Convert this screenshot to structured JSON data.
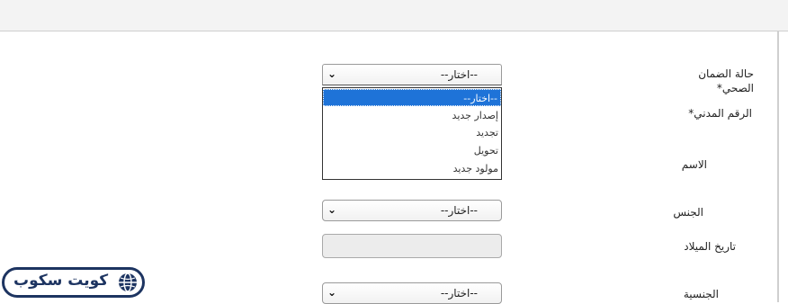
{
  "form": {
    "fields": {
      "status_label": "حالة الضمان الصحي*",
      "civil_id_label": "الرقم المدني*",
      "name_label": "الاسم",
      "gender_label": "الجنس",
      "dob_label": "تاريخ الميلاد",
      "nationality_label": "الجنسية"
    },
    "status_select": {
      "value": "--اختار--",
      "options": [
        "--اختار--",
        "إصدار جديد",
        "تجديد",
        "تحويل",
        "مولود جديد"
      ],
      "selected_index": 0
    },
    "gender_select": {
      "value": "--اختار--"
    },
    "nationality_select": {
      "value": "--اختار--"
    },
    "dob_input": {
      "value": ""
    }
  },
  "watermark": {
    "text": "كويت سكوب",
    "icon": "globe-icon"
  },
  "colors": {
    "highlight": "#1e73d8",
    "logo": "#1d3461"
  }
}
